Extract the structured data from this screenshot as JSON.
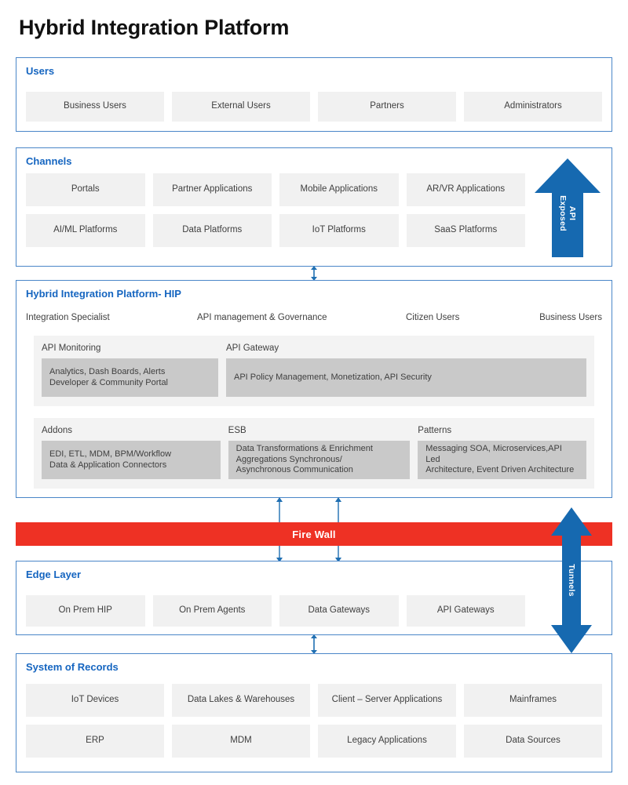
{
  "page": {
    "title": "Hybrid Integration Platform"
  },
  "colors": {
    "accent_blue": "#1565c0",
    "border_blue": "#4a86c8",
    "arrow_blue": "#1669b0",
    "firewall_red": "#ee3124",
    "chip_grey": "#f1f1f1",
    "panel_grey": "#f3f3f3",
    "box_grey": "#c9c9c9"
  },
  "users": {
    "title": "Users",
    "items": [
      "Business Users",
      "External Users",
      "Partners",
      "Administrators"
    ]
  },
  "channels": {
    "title": "Channels",
    "row1": [
      "Portals",
      "Partner Applications",
      "Mobile Applications",
      "AR/VR Applications"
    ],
    "row2": [
      "AI/ML Platforms",
      "Data Platforms",
      "IoT Platforms",
      "SaaS Platforms"
    ],
    "api_arrow": {
      "label_line1": "API",
      "label_line2": "Exposed",
      "direction": "up",
      "icon": "arrow-up-icon"
    }
  },
  "hip": {
    "title": "Hybrid Integration Platform-  HIP",
    "personas": [
      "Integration Specialist",
      "API management & Governance",
      "Citizen Users",
      "Business Users"
    ],
    "panel1": [
      {
        "title": "API Monitoring",
        "body": "Analytics, Dash Boards, Alerts\nDeveloper & Community Portal"
      },
      {
        "title": "API Gateway",
        "body": "API Policy Management, Monetization, API Security"
      }
    ],
    "panel2": [
      {
        "title": "Addons",
        "body": "EDI, ETL, MDM, BPM/Workflow\nData & Application Connectors"
      },
      {
        "title": "ESB",
        "body": "Data Transformations & Enrichment\nAggregations Synchronous/\nAsynchronous Communication"
      },
      {
        "title": "Patterns",
        "body": "Messaging SOA, Microservices,API Led\nArchitecture, Event Driven Architecture"
      }
    ]
  },
  "firewall": {
    "label": "Fire Wall"
  },
  "edge": {
    "title": "Edge Layer",
    "items": [
      "On Prem HIP",
      "On Prem Agents",
      "Data Gateways",
      "API Gateways"
    ]
  },
  "tunnels": {
    "label": "Tunnels",
    "direction": "up-down",
    "icon": "arrow-up-down-icon"
  },
  "system_of_records": {
    "title": "System of Records",
    "row1": [
      "IoT Devices",
      "Data Lakes & Warehouses",
      "Client – Server Applications",
      "Mainframes"
    ],
    "row2": [
      "ERP",
      "MDM",
      "Legacy Applications",
      "Data Sources"
    ]
  },
  "connectors": [
    {
      "name": "channels-to-hip",
      "direction": "up-down"
    },
    {
      "name": "hip-to-edge-left",
      "direction": "up-down"
    },
    {
      "name": "hip-to-edge-right",
      "direction": "up-down"
    },
    {
      "name": "edge-to-system-of-records",
      "direction": "up-down"
    }
  ]
}
